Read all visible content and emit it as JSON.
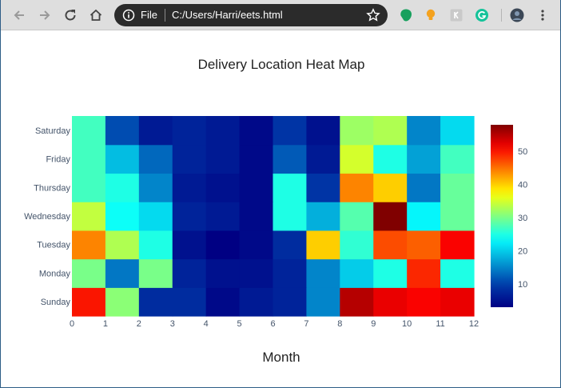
{
  "browser": {
    "file_label": "File",
    "url": "C:/Users/Harri/eets.html",
    "icons": [
      "back-arrow-icon",
      "forward-arrow-icon",
      "reload-icon",
      "home-icon",
      "info-icon",
      "star-icon",
      "evernote-icon",
      "lightbulb-icon",
      "reader-extension-icon",
      "grammarly-icon",
      "profile-avatar",
      "kebab-menu-icon"
    ]
  },
  "chart_data": {
    "type": "heatmap",
    "title": "Delivery Location Heat Map",
    "xlabel": "Month",
    "ylabel": "",
    "x_ticks": [
      "0",
      "1",
      "2",
      "3",
      "4",
      "5",
      "6",
      "7",
      "8",
      "9",
      "10",
      "11",
      "12"
    ],
    "xlim": [
      0,
      12
    ],
    "y_categories": [
      "Sunday",
      "Monday",
      "Tuesday",
      "Wednesday",
      "Thursday",
      "Friday",
      "Saturday"
    ],
    "colorscale": "Jet",
    "zlim": [
      3,
      58
    ],
    "colorbar_ticks": [
      "10",
      "20",
      "30",
      "40",
      "50"
    ],
    "z": [
      [
        50,
        31,
        8,
        8,
        4,
        6,
        7,
        15,
        55,
        52,
        51,
        52
      ],
      [
        30,
        14,
        30,
        7,
        5,
        5,
        7,
        15,
        20,
        25,
        49,
        25
      ],
      [
        44,
        33,
        25,
        5,
        3,
        4,
        8,
        40,
        26,
        47,
        46,
        51
      ],
      [
        34,
        24,
        21,
        7,
        6,
        4,
        25,
        18,
        28,
        58,
        23,
        29
      ],
      [
        27,
        25,
        15,
        6,
        5,
        4,
        25,
        9,
        44,
        40,
        14,
        29
      ],
      [
        27,
        19,
        13,
        7,
        6,
        4,
        12,
        6,
        35,
        25,
        17,
        27
      ],
      [
        27,
        11,
        6,
        7,
        6,
        4,
        9,
        5,
        32,
        33,
        15,
        21
      ]
    ]
  }
}
